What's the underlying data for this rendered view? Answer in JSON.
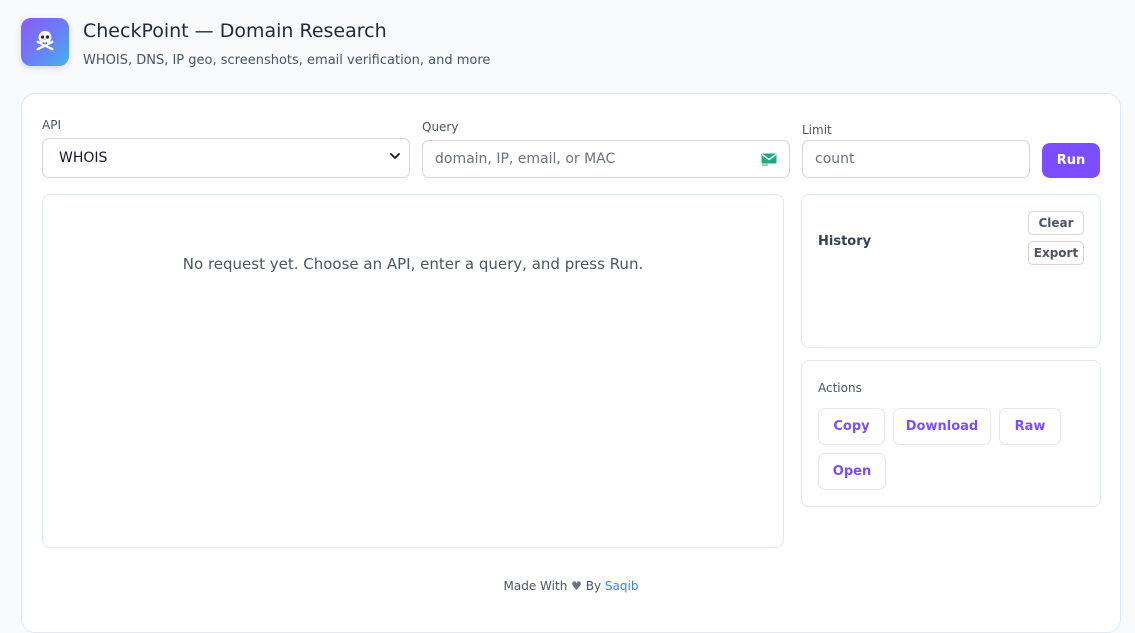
{
  "header": {
    "title": "CheckPoint — Domain Research",
    "subtitle": "WHOIS, DNS, IP geo, screenshots, email verification, and more",
    "logo_icon": "skull-crossbones-icon"
  },
  "form": {
    "api_label": "API",
    "api_selected": "WHOIS",
    "query_label": "Query",
    "query_placeholder": "domain, IP, email, or MAC",
    "limit_label": "Limit",
    "limit_placeholder": "count",
    "run_label": "Run"
  },
  "result": {
    "empty_message": "No request yet. Choose an API, enter a query, and press Run."
  },
  "history": {
    "title": "History",
    "clear_label": "Clear",
    "export_label": "Export"
  },
  "actions": {
    "title": "Actions",
    "copy_label": "Copy",
    "download_label": "Download",
    "raw_label": "Raw",
    "open_label": "Open"
  },
  "footer": {
    "made_with": "Made With",
    "heart": "♥",
    "by": "By",
    "author": "Saqib"
  },
  "colors": {
    "accent": "#7c4dff",
    "link": "#3b82f6",
    "logo_gradient_start": "#8b5cf6",
    "logo_gradient_end": "#3fb5f0"
  }
}
